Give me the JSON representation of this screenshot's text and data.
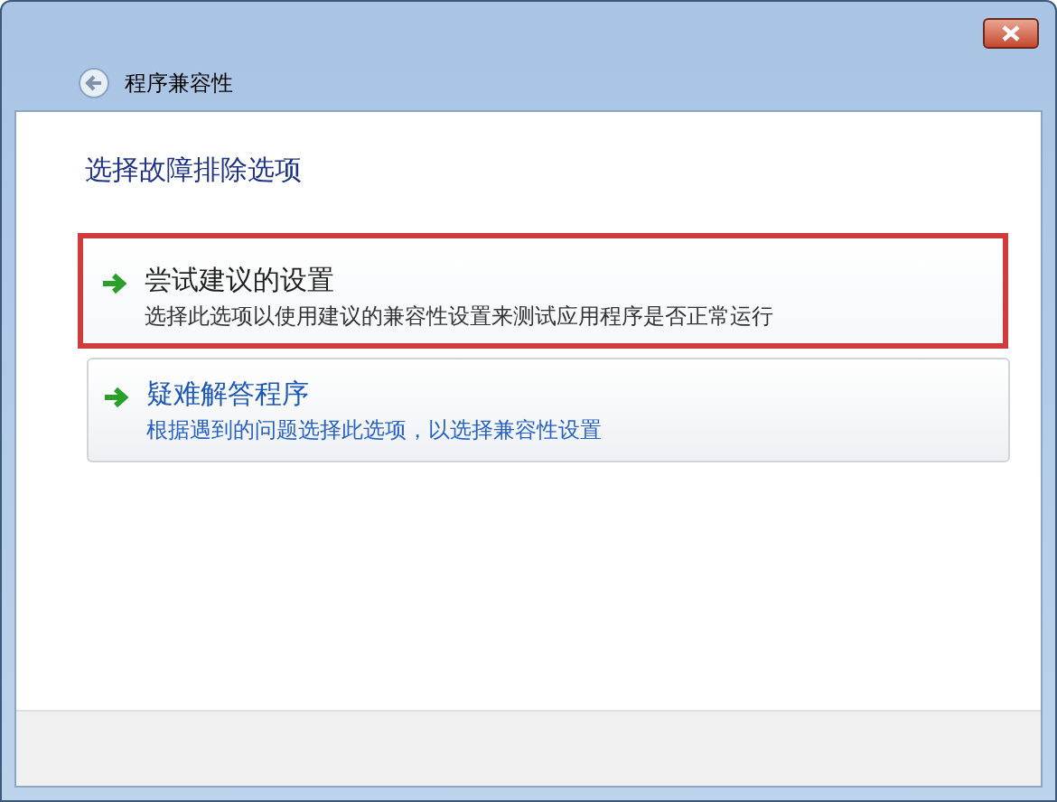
{
  "window": {
    "title": "程序兼容性"
  },
  "heading": "选择故障排除选项",
  "options": [
    {
      "title": "尝试建议的设置",
      "description": "选择此选项以使用建议的兼容性设置来测试应用程序是否正常运行",
      "selected": true
    },
    {
      "title": "疑难解答程序",
      "description": "根据遇到的问题选择此选项，以选择兼容性设置",
      "selected": false
    }
  ]
}
